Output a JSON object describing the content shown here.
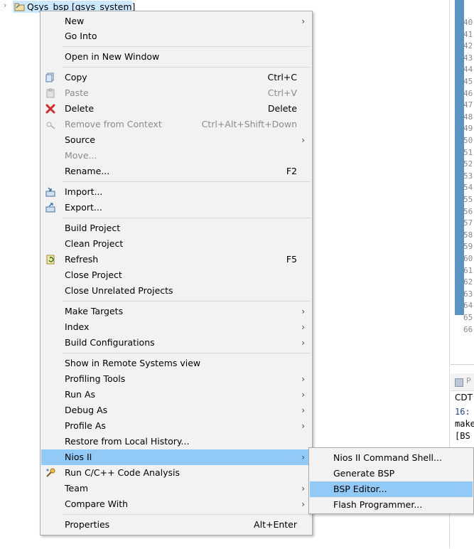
{
  "project_tree": {
    "label": "Qsys_bsp [qsys_system]"
  },
  "editor": {
    "line_numbers": [
      "40",
      "41",
      "42",
      "43",
      "44",
      "45",
      "46",
      "47",
      "48",
      "49",
      "50",
      "51",
      "52",
      "53",
      "54",
      "55",
      "56",
      "57",
      "58",
      "59",
      "60",
      "61",
      "62",
      "63",
      "64",
      "65",
      "66"
    ]
  },
  "console": {
    "tab_label": "P",
    "lines": [
      "CDT",
      "16:",
      "make",
      "[BS"
    ]
  },
  "context_menu": {
    "items": [
      {
        "label": "New",
        "shortcut": "",
        "submenu": true,
        "enabled": true,
        "icon": ""
      },
      {
        "label": "Go Into",
        "shortcut": "",
        "submenu": false,
        "enabled": true,
        "icon": ""
      },
      {
        "label": "Open in New Window",
        "shortcut": "",
        "submenu": false,
        "enabled": true,
        "icon": ""
      },
      {
        "label": "Copy",
        "shortcut": "Ctrl+C",
        "submenu": false,
        "enabled": true,
        "icon": "copy-icon"
      },
      {
        "label": "Paste",
        "shortcut": "Ctrl+V",
        "submenu": false,
        "enabled": false,
        "icon": "paste-icon"
      },
      {
        "label": "Delete",
        "shortcut": "Delete",
        "submenu": false,
        "enabled": true,
        "icon": "delete-icon"
      },
      {
        "label": "Remove from Context",
        "shortcut": "Ctrl+Alt+Shift+Down",
        "submenu": false,
        "enabled": false,
        "icon": "remove-context-icon"
      },
      {
        "label": "Source",
        "shortcut": "",
        "submenu": true,
        "enabled": true,
        "icon": ""
      },
      {
        "label": "Move...",
        "shortcut": "",
        "submenu": false,
        "enabled": false,
        "icon": ""
      },
      {
        "label": "Rename...",
        "shortcut": "F2",
        "submenu": false,
        "enabled": true,
        "icon": ""
      },
      {
        "label": "Import...",
        "shortcut": "",
        "submenu": false,
        "enabled": true,
        "icon": "import-icon"
      },
      {
        "label": "Export...",
        "shortcut": "",
        "submenu": false,
        "enabled": true,
        "icon": "export-icon"
      },
      {
        "label": "Build Project",
        "shortcut": "",
        "submenu": false,
        "enabled": true,
        "icon": ""
      },
      {
        "label": "Clean Project",
        "shortcut": "",
        "submenu": false,
        "enabled": true,
        "icon": ""
      },
      {
        "label": "Refresh",
        "shortcut": "F5",
        "submenu": false,
        "enabled": true,
        "icon": "refresh-icon"
      },
      {
        "label": "Close Project",
        "shortcut": "",
        "submenu": false,
        "enabled": true,
        "icon": ""
      },
      {
        "label": "Close Unrelated Projects",
        "shortcut": "",
        "submenu": false,
        "enabled": true,
        "icon": ""
      },
      {
        "label": "Make Targets",
        "shortcut": "",
        "submenu": true,
        "enabled": true,
        "icon": ""
      },
      {
        "label": "Index",
        "shortcut": "",
        "submenu": true,
        "enabled": true,
        "icon": ""
      },
      {
        "label": "Build Configurations",
        "shortcut": "",
        "submenu": true,
        "enabled": true,
        "icon": ""
      },
      {
        "label": "Show in Remote Systems view",
        "shortcut": "",
        "submenu": false,
        "enabled": true,
        "icon": ""
      },
      {
        "label": "Profiling Tools",
        "shortcut": "",
        "submenu": true,
        "enabled": true,
        "icon": ""
      },
      {
        "label": "Run As",
        "shortcut": "",
        "submenu": true,
        "enabled": true,
        "icon": ""
      },
      {
        "label": "Debug As",
        "shortcut": "",
        "submenu": true,
        "enabled": true,
        "icon": ""
      },
      {
        "label": "Profile As",
        "shortcut": "",
        "submenu": true,
        "enabled": true,
        "icon": ""
      },
      {
        "label": "Restore from Local History...",
        "shortcut": "",
        "submenu": false,
        "enabled": true,
        "icon": ""
      },
      {
        "label": "Nios II",
        "shortcut": "",
        "submenu": true,
        "enabled": true,
        "icon": "",
        "highlighted": true
      },
      {
        "label": "Run C/C++ Code Analysis",
        "shortcut": "",
        "submenu": false,
        "enabled": true,
        "icon": "code-analysis-icon"
      },
      {
        "label": "Team",
        "shortcut": "",
        "submenu": true,
        "enabled": true,
        "icon": ""
      },
      {
        "label": "Compare With",
        "shortcut": "",
        "submenu": true,
        "enabled": true,
        "icon": ""
      },
      {
        "label": "Properties",
        "shortcut": "Alt+Enter",
        "submenu": false,
        "enabled": true,
        "icon": ""
      }
    ]
  },
  "nios_submenu": {
    "items": [
      {
        "label": "Nios II Command Shell..."
      },
      {
        "label": "Generate BSP"
      },
      {
        "label": "BSP Editor...",
        "highlighted": true
      },
      {
        "label": "Flash Programmer..."
      }
    ]
  },
  "colors": {
    "highlight": "#91c9f7",
    "menu_background": "#f2f2f2",
    "tree_selection": "#cce8ff",
    "ruler": "#5a93c4"
  }
}
